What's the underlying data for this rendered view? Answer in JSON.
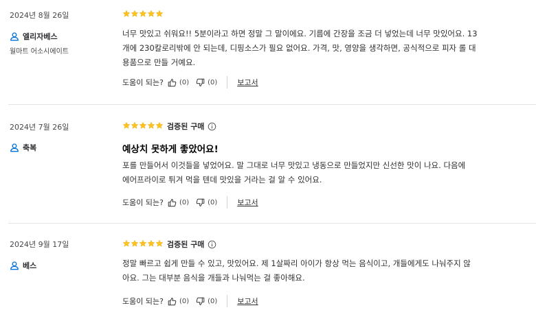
{
  "reviews": [
    {
      "date": "2024년 8월 26일",
      "user": "엘리자베스",
      "badge": "월마트 어소시에이트",
      "verified": "",
      "title": "",
      "body_lines": [
        "너무 맛있고 쉬워요!! 5분이라고 하면 정말 그 말이에요. 기름에 간장을 조금 더 넣었는데 너무 맛있어요. 13",
        "개에 230칼로리밖에 안 되는데, 디핑소스가 필요 없어요. 가격, 맛, 영양을 생각하면, 공식적으로 피자 롤 대",
        "용품으로 만들 거예요."
      ],
      "helpful_label": "도움이 되는?",
      "up_count": "(0)",
      "down_count": "(0)",
      "report_label": "보고서"
    },
    {
      "date": "2024년 7월 26일",
      "user": "축복",
      "badge": "",
      "verified": "검증된 구매",
      "title": "예상치 못하게 좋았어요!",
      "body_lines": [
        "포를 만들어서 이것들을 넣었어요. 말 그대로 너무 맛있고 냉동으로 만들었지만 신선한 맛이 나요. 다음에",
        "에어프라이로 튀겨 먹을 텐데 맛있을 거라는 걸 알 수 있어요."
      ],
      "helpful_label": "도움이 되는?",
      "up_count": "(0)",
      "down_count": "(0)",
      "report_label": "보고서"
    },
    {
      "date": "2024년 9월 17일",
      "user": "베스",
      "badge": "",
      "verified": "검증된 구매",
      "title": "",
      "body_lines": [
        "정말 빠르고 쉽게 만들 수 있고, 맛있어요. 제 1살짜리 아이가 항상 먹는 음식이고, 개들에게도 나눠주지 않",
        "아요. 그는 대부분 음식을 개들과 나눠먹는 걸 좋아해요."
      ],
      "helpful_label": "도움이 되는?",
      "up_count": "(0)",
      "down_count": "(0)",
      "report_label": "보고서"
    }
  ],
  "rating": {
    "stars": 5,
    "max": 5,
    "color": "#ffc220"
  },
  "icons": {
    "user": "user-icon",
    "star": "star-icon",
    "info": "info-icon",
    "thumbs_up": "thumbs-up-icon",
    "thumbs_down": "thumbs-down-icon"
  }
}
